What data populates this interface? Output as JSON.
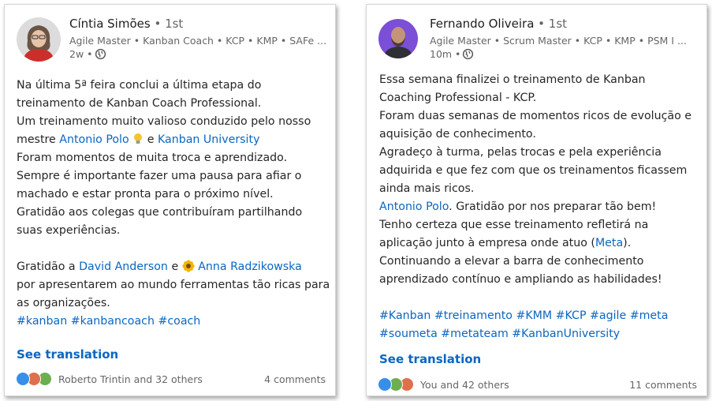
{
  "posts": [
    {
      "author": "Cíntia Simões",
      "degree": " • 1st",
      "headline": "Agile Master • Kanban Coach • KCP • KMP • SAFe ...",
      "time": "2w •",
      "lines": [
        [
          {
            "t": "Na última 5ª feira conclui a última etapa do"
          }
        ],
        [
          {
            "t": "treinamento de Kanban Coach Professional."
          }
        ],
        [
          {
            "t": "Um treinamento muito valioso conduzido pelo nosso"
          }
        ],
        [
          {
            "t": "mestre "
          },
          {
            "t": "Antonio Polo",
            "link": true
          },
          {
            "t": " "
          },
          {
            "emoji": "bulb"
          },
          {
            "t": " e "
          },
          {
            "t": "Kanban University",
            "link": true
          }
        ],
        [
          {
            "t": "Foram momentos de muita troca e aprendizado."
          }
        ],
        [
          {
            "t": "Sempre é importante fazer uma pausa para afiar o"
          }
        ],
        [
          {
            "t": "machado e estar pronta para o próximo nível."
          }
        ],
        [
          {
            "t": "Gratidão aos colegas que contribuíram partilhando"
          }
        ],
        [
          {
            "t": "suas experiências."
          }
        ],
        [],
        [
          {
            "t": "Gratidão a "
          },
          {
            "t": "David Anderson",
            "link": true
          },
          {
            "t": " e "
          },
          {
            "emoji": "flower"
          },
          {
            "t": " "
          },
          {
            "t": "Anna Radzikowska",
            "link": true
          }
        ],
        [
          {
            "t": "por apresentarem ao mundo ferramentas tão ricas para"
          }
        ],
        [
          {
            "t": "as organizações."
          }
        ],
        [
          {
            "t": "#kanban #kanbancoach #coach",
            "link": true
          }
        ]
      ],
      "see_translation": "See translation",
      "reactions_text": "Roberto Trintin and 32 others",
      "comments": "4 comments",
      "reaction_icons": [
        "like-icon",
        "celebrate-icon",
        "support-icon"
      ]
    },
    {
      "author": "Fernando Oliveira",
      "degree": " • 1st",
      "headline": "Agile Master • Scrum Master • KCP • KMP • PSM I ...",
      "time": "10m •",
      "lines": [
        [
          {
            "t": "Essa semana finalizei o treinamento de Kanban"
          }
        ],
        [
          {
            "t": "Coaching Professional - KCP."
          }
        ],
        [
          {
            "t": "Foram duas semanas de momentos ricos de evolução e"
          }
        ],
        [
          {
            "t": "aquisição de conhecimento."
          }
        ],
        [
          {
            "t": "Agradeço à turma, pelas trocas e pela experiência"
          }
        ],
        [
          {
            "t": "adquirida e que fez com que os treinamentos ficassem"
          }
        ],
        [
          {
            "t": "ainda mais ricos."
          }
        ],
        [
          {
            "t": "Antonio Polo",
            "link": true
          },
          {
            "t": ". Gratidão por nos preparar tão bem!"
          }
        ],
        [
          {
            "t": "Tenho certeza que esse treinamento refletirá na"
          }
        ],
        [
          {
            "t": "aplicação junto à empresa onde atuo ("
          },
          {
            "t": "Meta",
            "link": true
          },
          {
            "t": ")."
          }
        ],
        [
          {
            "t": "Continuando a elevar a barra de conhecimento"
          }
        ],
        [
          {
            "t": "aprendizado contínuo e ampliando as habilidades!"
          }
        ],
        [],
        [
          {
            "t": "#Kanban #treinamento #KMM #KCP #agile #meta",
            "link": true
          }
        ],
        [
          {
            "t": "#soumeta #metateam #KanbanUniversity",
            "link": true
          }
        ]
      ],
      "see_translation": "See translation",
      "reactions_text": "You and 42 others",
      "comments": "11 comments",
      "reaction_icons": [
        "like-icon",
        "celebrate-icon",
        "love-icon"
      ]
    }
  ],
  "colors": {
    "link": "#0a66c2",
    "like": "#378fe9",
    "celebrate": "#44712e",
    "support": "#c37d16",
    "love": "#df704d"
  }
}
